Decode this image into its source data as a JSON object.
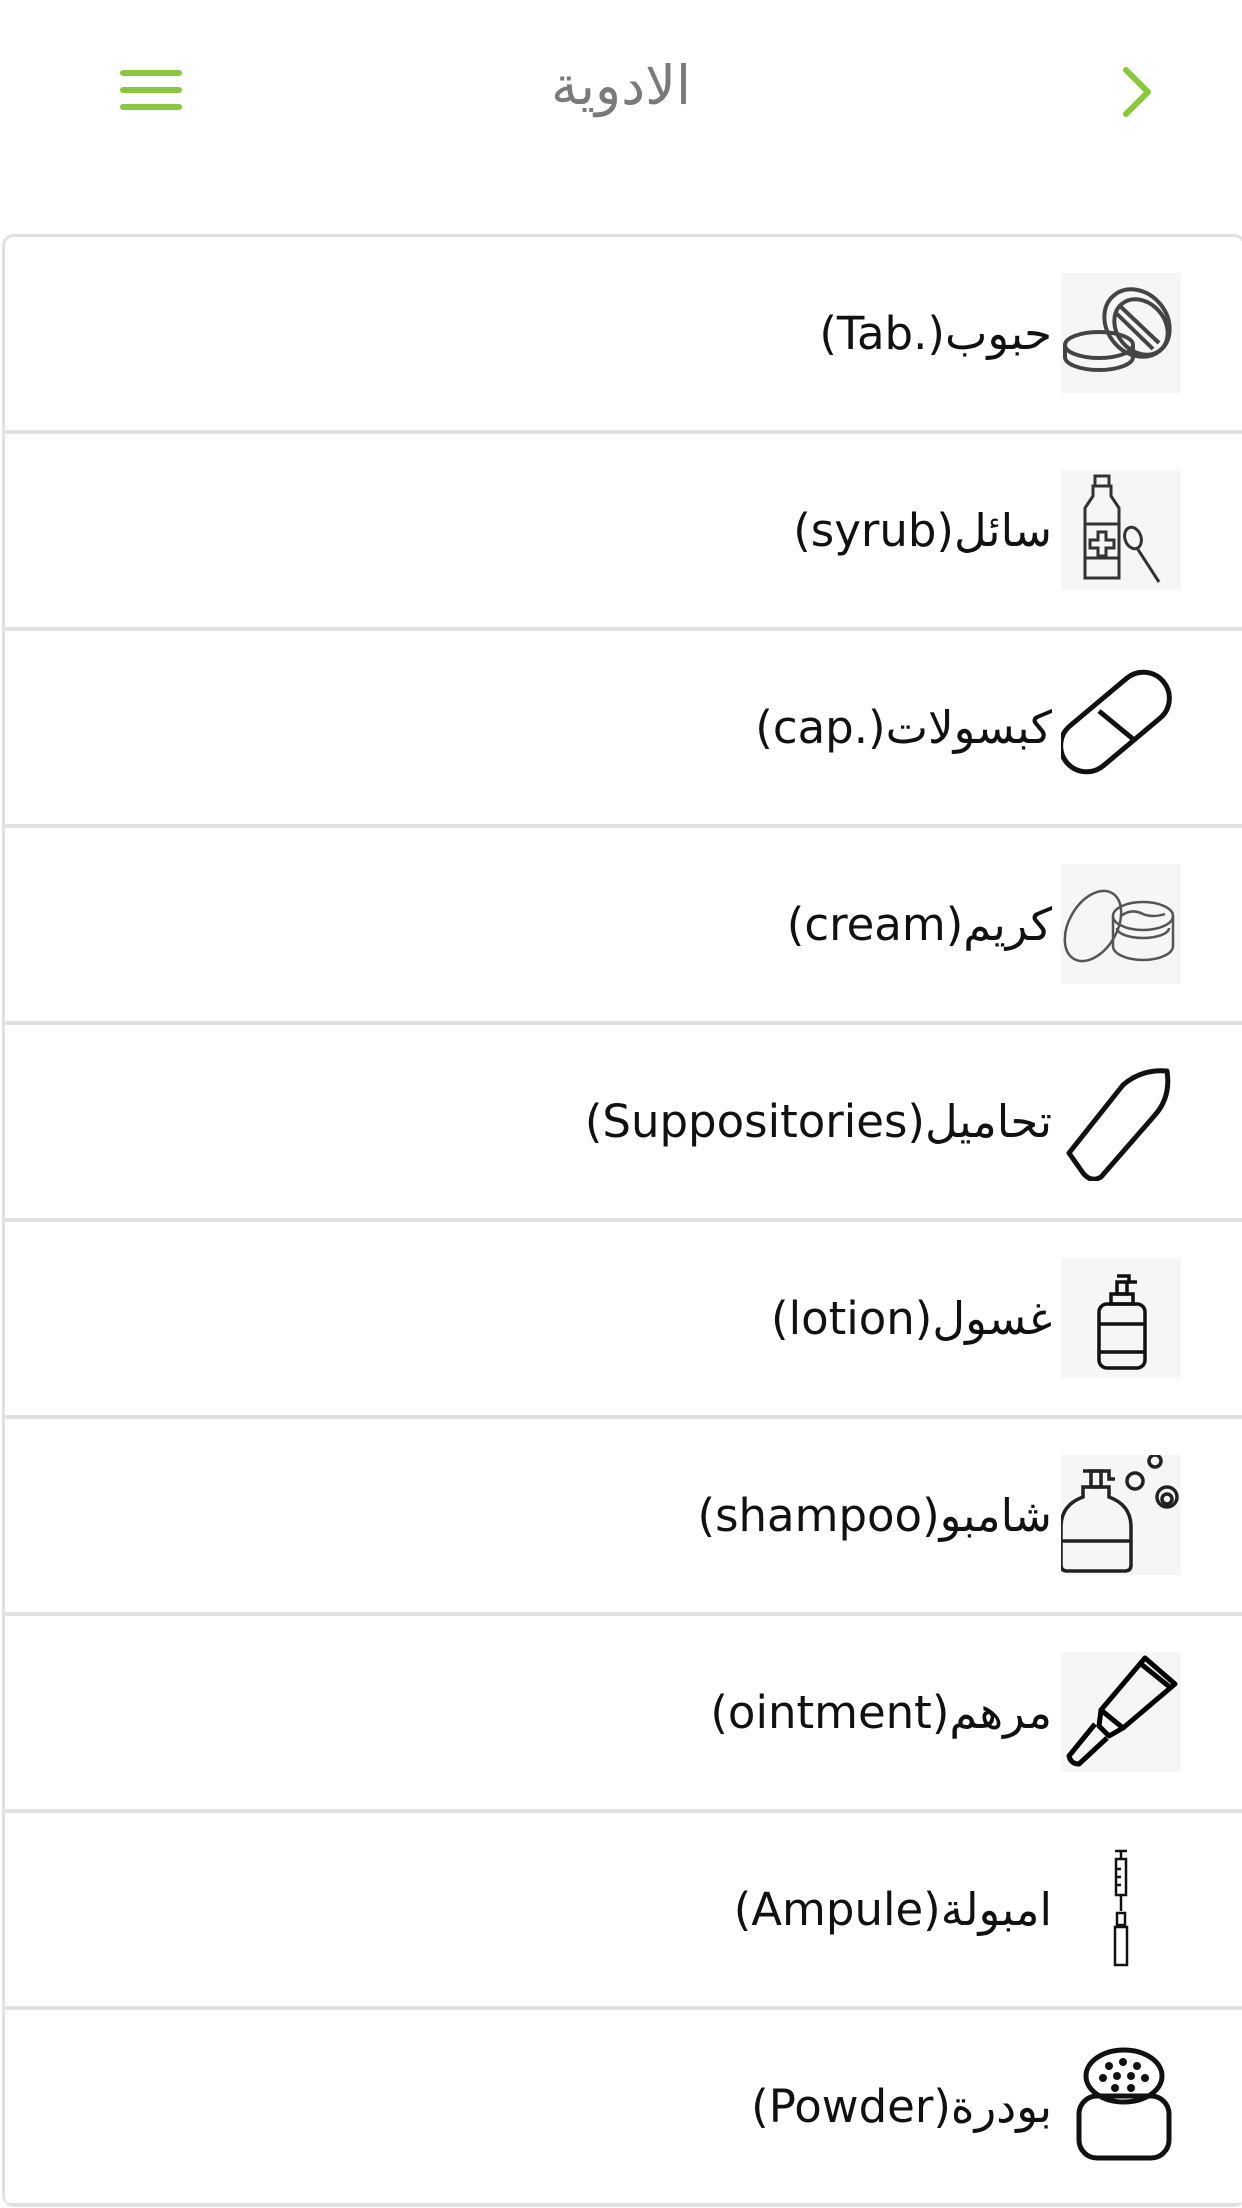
{
  "header": {
    "title": "الادوية",
    "menu_icon": "menu-icon",
    "back_icon": "chevron-right-icon",
    "accent_color": "#8cc63f"
  },
  "items": [
    {
      "arabic": "حبوب",
      "english": "(Tab.)",
      "icon": "tablet-icon"
    },
    {
      "arabic": "سائل",
      "english": "(syrub)",
      "icon": "syrup-bottle-icon"
    },
    {
      "arabic": "كبسولات",
      "english": "(cap.)",
      "icon": "capsule-icon"
    },
    {
      "arabic": "كريم",
      "english": "(cream)",
      "icon": "cream-jar-icon"
    },
    {
      "arabic": "تحاميل",
      "english": "(Suppositories)",
      "icon": "suppository-icon"
    },
    {
      "arabic": "غسول",
      "english": "(lotion)",
      "icon": "lotion-pump-icon"
    },
    {
      "arabic": "شامبو",
      "english": "(shampoo)",
      "icon": "shampoo-bottle-icon"
    },
    {
      "arabic": "مرهم",
      "english": "(ointment)",
      "icon": "ointment-tube-icon"
    },
    {
      "arabic": "امبولة",
      "english": "(Ampule)",
      "icon": "ampule-syringe-icon"
    },
    {
      "arabic": "بودرة",
      "english": "(Powder)",
      "icon": "powder-container-icon"
    }
  ]
}
